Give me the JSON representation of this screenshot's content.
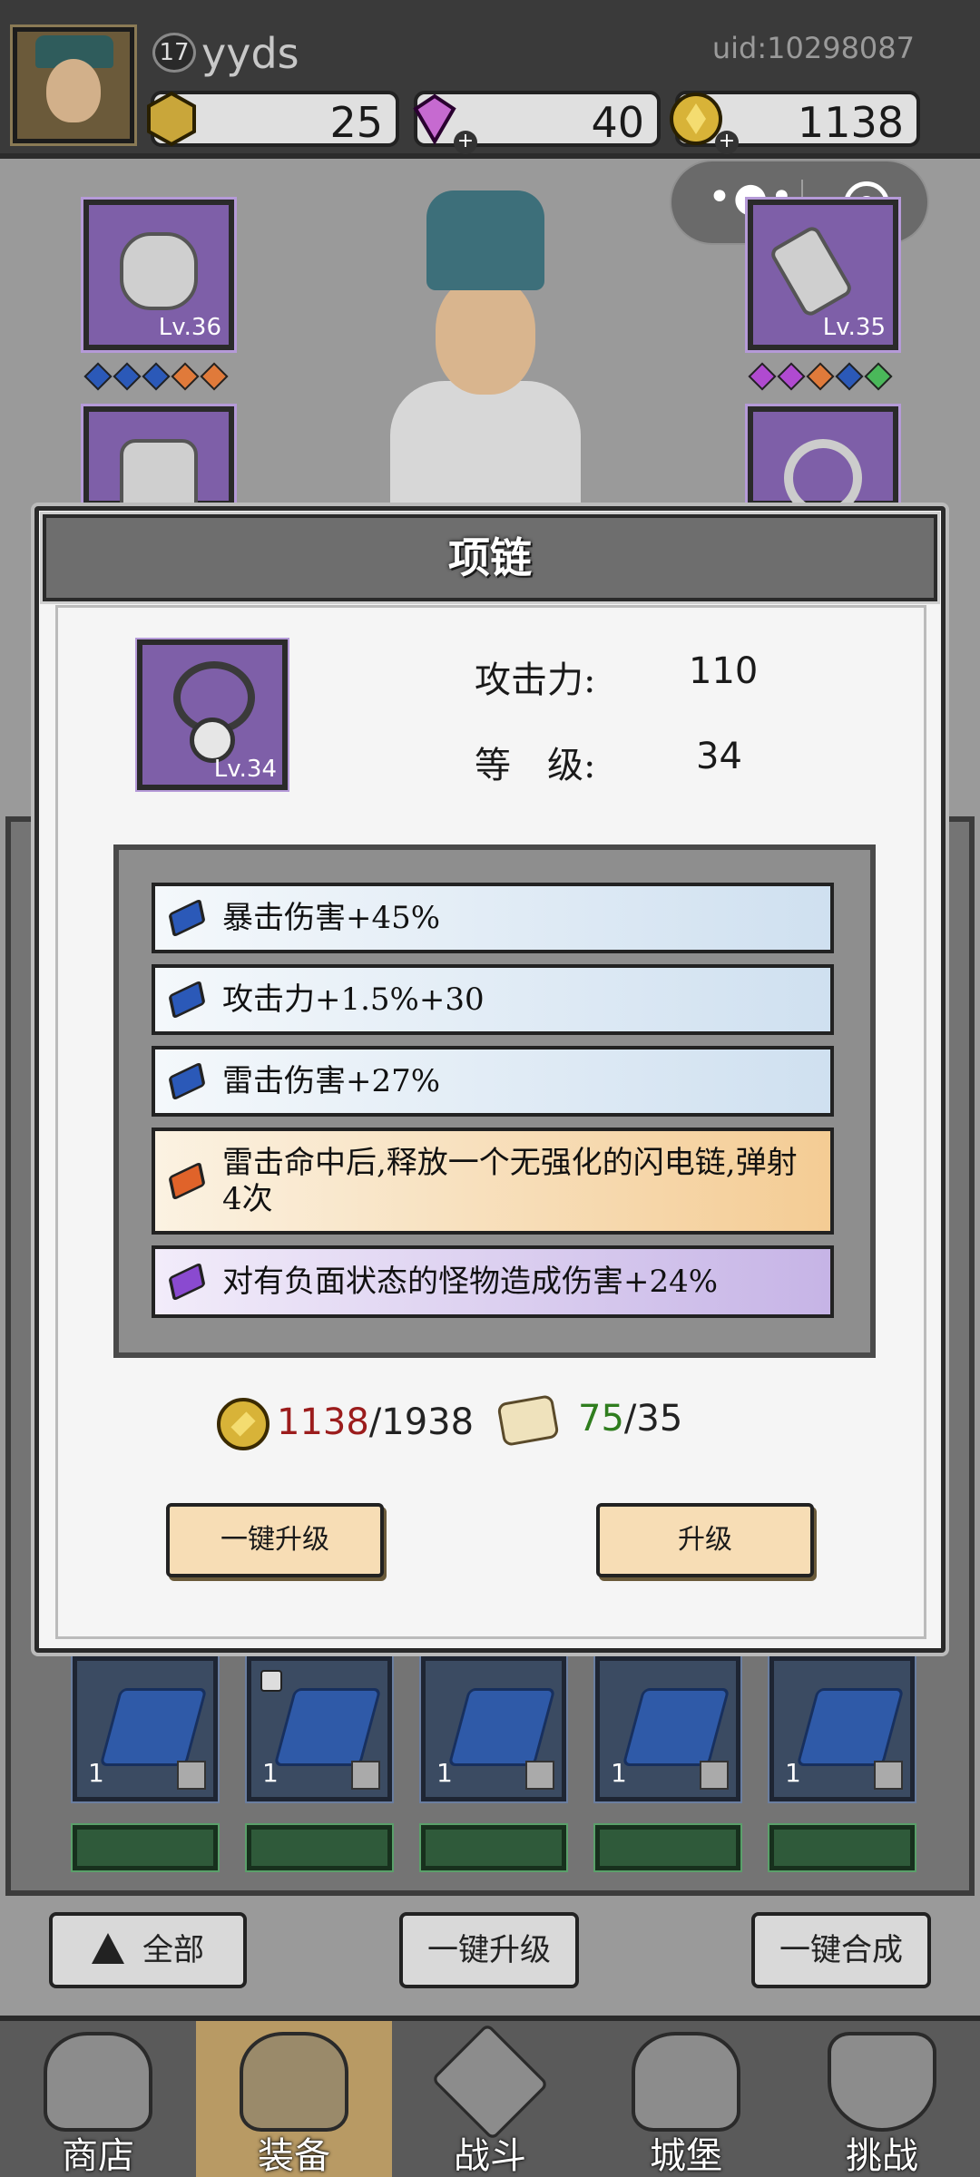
{
  "header": {
    "level": "17",
    "username": "yyds",
    "uid": "uid:10298087",
    "resources": [
      {
        "name": "stamina",
        "icon": "hexagon-gold-icon",
        "value": "25",
        "color": "#c9a63a"
      },
      {
        "name": "diamond",
        "icon": "gem-pink-icon",
        "value": "40",
        "color": "#c66ad0"
      },
      {
        "name": "gold",
        "icon": "gold-coin-icon",
        "value": "1138",
        "color": "#d8b338"
      }
    ]
  },
  "equipment": {
    "left_top_level": "Lv.36",
    "right_top_level": "Lv.35",
    "left_gems": [
      "#2b59b8",
      "#2b59b8",
      "#2b59b8",
      "#e07a3a",
      "#e07a3a"
    ],
    "right_gems": [
      "#b04ad0",
      "#b04ad0",
      "#e07a3a",
      "#2b59b8",
      "#4ab85a"
    ]
  },
  "modal": {
    "title": "项链",
    "item_level": "Lv.34",
    "stats": [
      {
        "label": "攻击力:",
        "value": "110"
      },
      {
        "label": "等　级:",
        "value": "34"
      }
    ],
    "affixes": [
      {
        "text": "暴击伤害+45%",
        "tier": "blue",
        "gem_color": "#2b59b8"
      },
      {
        "text": "攻击力+1.5%+30",
        "tier": "blue",
        "gem_color": "#2b59b8"
      },
      {
        "text": "雷击伤害+27%",
        "tier": "blue",
        "gem_color": "#2b59b8"
      },
      {
        "text": "雷击命中后,释放一个无强化的闪电链,弹射4次",
        "tier": "orange",
        "gem_color": "#e0632a"
      },
      {
        "text": "对有负面状态的怪物造成伤害+24%",
        "tier": "purple",
        "gem_color": "#8a4ad0"
      }
    ],
    "gold_cost": {
      "have": "1138",
      "need": "/1938"
    },
    "scroll_cost": {
      "have": "75",
      "need": "/35"
    },
    "one_click_upgrade": "一键升级",
    "upgrade": "升级"
  },
  "bag": {
    "gem_counts": [
      "1",
      "1",
      "1",
      "1",
      "1"
    ]
  },
  "actions": {
    "filter_all": "全部",
    "one_click_upgrade": "一键升级",
    "one_click_merge": "一键合成"
  },
  "tabs": [
    {
      "label": "商店",
      "icon": "shop-hut-icon"
    },
    {
      "label": "装备",
      "icon": "backpack-icon"
    },
    {
      "label": "战斗",
      "icon": "crossed-swords-icon"
    },
    {
      "label": "城堡",
      "icon": "castle-tower-icon"
    },
    {
      "label": "挑战",
      "icon": "challenge-shield-icon"
    }
  ]
}
